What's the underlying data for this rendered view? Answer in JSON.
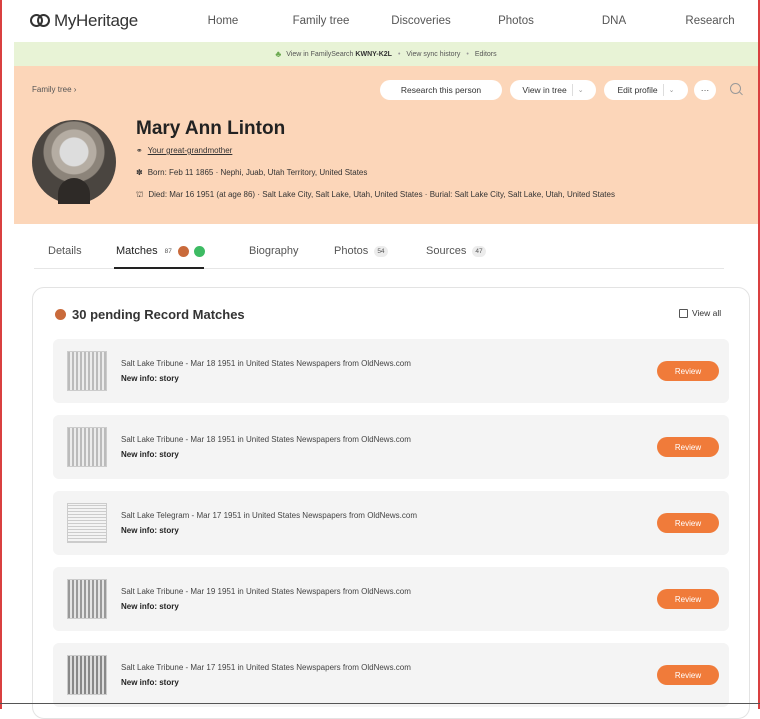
{
  "nav": {
    "brand": "MyHeritage",
    "items": [
      "Home",
      "Family tree",
      "Discoveries",
      "Photos",
      "DNA",
      "Research"
    ]
  },
  "sync": {
    "view_prefix": "View in FamilySearch",
    "fs_id": "KWNY-K2L",
    "history": "View sync history",
    "editors": "Editors"
  },
  "header": {
    "breadcrumb": "Family tree ›",
    "research_button": "Research this person",
    "view_tree_button": "View in tree",
    "edit_profile_button": "Edit profile",
    "more_button": "···",
    "name": "Mary Ann Linton",
    "relation": "Your great-grandmother",
    "born": "Born: Feb 11 1865 · Nephi, Juab, Utah Territory, United States",
    "died": "Died: Mar 16 1951 (at age 86) · Salt Lake City, Salt Lake, Utah, United States · Burial: Salt Lake City, Salt Lake, Utah, United States"
  },
  "tabs": {
    "details": "Details",
    "matches": "Matches",
    "matches_count": "87",
    "biography": "Biography",
    "photos": "Photos",
    "photos_count": "54",
    "sources": "Sources",
    "sources_count": "47"
  },
  "card": {
    "title": "30 pending Record Matches",
    "view_all": "View all",
    "new_info_label": "New info:",
    "review_label": "Review",
    "rows": [
      {
        "title": "Salt Lake Tribune - Mar 18 1951 in United States Newspapers from OldNews.com",
        "info": "story"
      },
      {
        "title": "Salt Lake Tribune - Mar 18 1951 in United States Newspapers from OldNews.com",
        "info": "story"
      },
      {
        "title": "Salt Lake Telegram - Mar 17 1951 in United States Newspapers from OldNews.com",
        "info": "story"
      },
      {
        "title": "Salt Lake Tribune - Mar 19 1951 in United States Newspapers from OldNews.com",
        "info": "story"
      },
      {
        "title": "Salt Lake Tribune - Mar 17 1951 in United States Newspapers from OldNews.com",
        "info": "story"
      }
    ]
  },
  "colors": {
    "header_bg": "#fcd6b9",
    "sync_bg": "#e8f3d6",
    "review_button": "#f07b3a",
    "match_badge_orange": "#c96a3b",
    "match_badge_green": "#3dbb63"
  }
}
